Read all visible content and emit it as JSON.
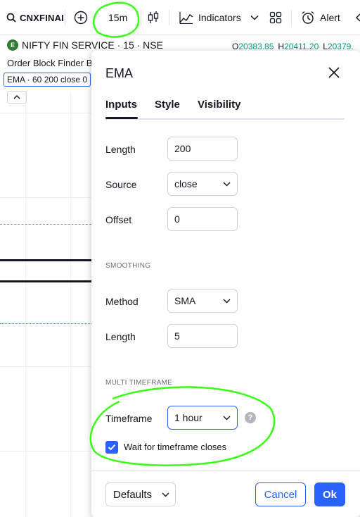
{
  "toolbar": {
    "symbol": "CNXFINAI",
    "interval": "15m",
    "indicators_label": "Indicators",
    "alert_label": "Alert"
  },
  "chart": {
    "symbol_title": "NIFTY FIN SERVICE · 15 · NSE",
    "ohlc": {
      "o_label": "O",
      "o_value": "20383.85",
      "h_label": "H",
      "h_value": "20411.20",
      "l_label": "L",
      "l_value": "20379."
    },
    "indicator_1": "Order Block Finder B",
    "indicator_2": "EMA · 60 200 close 0"
  },
  "dialog": {
    "title": "EMA",
    "tabs": [
      "Inputs",
      "Style",
      "Visibility"
    ],
    "active_tab": "Inputs",
    "inputs": {
      "length_label": "Length",
      "length_value": "200",
      "source_label": "Source",
      "source_value": "close",
      "offset_label": "Offset",
      "offset_value": "0"
    },
    "smoothing": {
      "section_title": "SMOOTHING",
      "method_label": "Method",
      "method_value": "SMA",
      "length_label": "Length",
      "length_value": "5"
    },
    "multi_timeframe": {
      "section_title": "MULTI TIMEFRAME",
      "timeframe_label": "Timeframe",
      "timeframe_value": "1 hour",
      "help_glyph": "?",
      "wait_label": "Wait for timeframe closes",
      "wait_checked": true
    },
    "footer": {
      "defaults_label": "Defaults",
      "cancel_label": "Cancel",
      "ok_label": "Ok"
    }
  },
  "colors": {
    "accent": "#2962ff",
    "text": "#131722",
    "up": "#089981",
    "annotation": "#39ff14"
  },
  "icons": [
    "search-icon",
    "add-compare-icon",
    "candles-icon",
    "indicators-icon",
    "chevron-down-icon",
    "layout-grid-icon",
    "alert-clock-icon",
    "close-icon",
    "check-icon",
    "help-icon"
  ]
}
